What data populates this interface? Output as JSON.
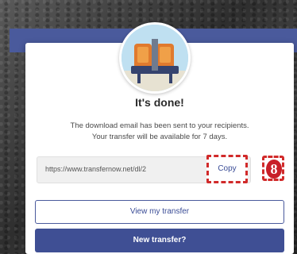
{
  "dialog": {
    "title": "It's done!",
    "message_line1": "The download email has been sent to your recipients.",
    "message_line2": "Your transfer will be available for 7 days."
  },
  "link": {
    "url": "https://www.transfernow.net/dl/2"
  },
  "buttons": {
    "copy_label": "Copy",
    "view_label": "View my transfer",
    "new_label": "New transfer?"
  },
  "annotation": {
    "step_number": "8"
  },
  "colors": {
    "brand": "#4a5a9c",
    "annotation_red": "#d12a2a"
  },
  "icons": {
    "illustration": "seat-illustration"
  }
}
